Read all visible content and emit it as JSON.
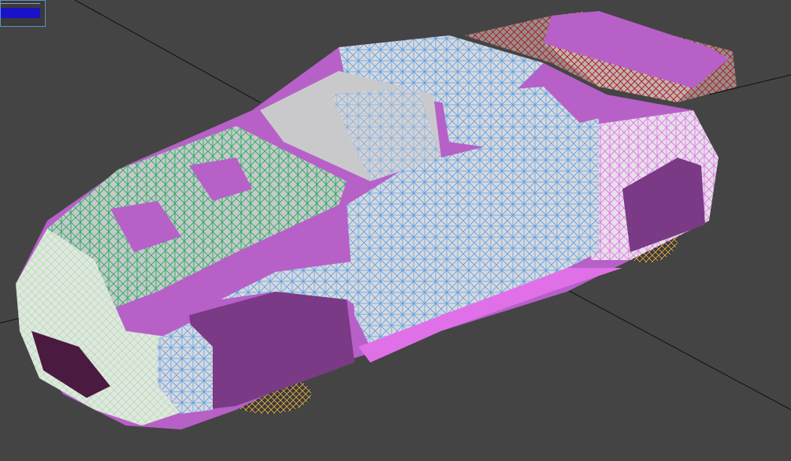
{
  "viewport": {
    "background_color": "#444444",
    "grid_line_color": "#111111",
    "body_color": "#b760c8",
    "body_dark_color": "#7a3a86",
    "glass_color": "#c9c9cc",
    "mesh_colors": {
      "hood": "#1fae5a",
      "side": "#5aa0e6",
      "front": "#a8e8a0",
      "spoiler": "#b01818",
      "wheels": "#e6b04a",
      "pink": "#e070e8"
    }
  },
  "color_swatch": {
    "active_color": "#1a12c8"
  }
}
